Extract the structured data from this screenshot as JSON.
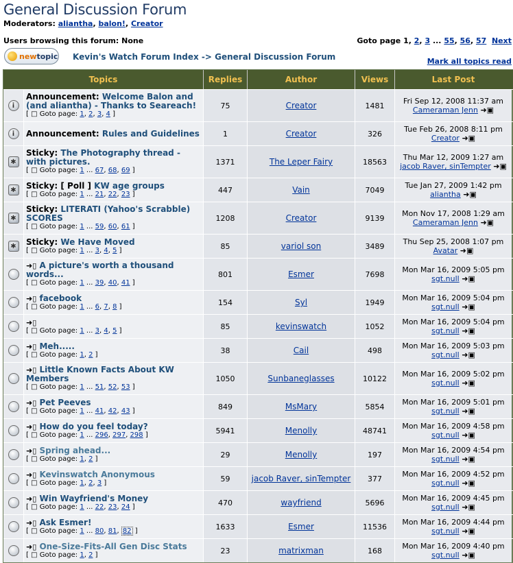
{
  "page": {
    "title": "General Discussion Forum",
    "moderators_label": "Moderators:",
    "moderators": [
      "aliantha",
      "balon!",
      "Creator"
    ],
    "browsing": "Users browsing this forum: None",
    "goto_label": "Goto page",
    "goto_current": "1",
    "goto_pages": [
      "2",
      "3",
      "...",
      "55",
      "56",
      "57"
    ],
    "goto_next": "Next",
    "new_topic_new": "new",
    "new_topic_topic": "topic",
    "breadcrumb": "Kevin's Watch Forum Index -> General Discussion Forum",
    "mark_all": "Mark all topics read"
  },
  "headers": {
    "topics": "Topics",
    "replies": "Replies",
    "author": "Author",
    "views": "Views",
    "last_post": "Last Post"
  },
  "colors": {
    "header_bg": "#4a5a2e",
    "header_text": "#f0c050",
    "link": "#003399",
    "title": "#1f3a64"
  },
  "goto_label_small": "Goto page:",
  "topics": [
    {
      "icon": "announcement-icon",
      "prefix": "Announcement:",
      "title": "Welcome Balon and (and aliantha) - Thanks to Seareach!",
      "pages": [
        "1",
        "2",
        "3",
        "4"
      ],
      "replies": "75",
      "author": "Creator",
      "views": "1481",
      "last_date": "Fri Sep 12, 2008 11:37 am",
      "last_user": "Cameraman Jenn"
    },
    {
      "icon": "announcement-icon",
      "prefix": "Announcement:",
      "title": "Rules and Guidelines",
      "pages": [],
      "replies": "1",
      "author": "Creator",
      "views": "326",
      "last_date": "Tue Feb 26, 2008 8:11 pm",
      "last_user": "Creator"
    },
    {
      "icon": "sticky-icon",
      "prefix": "Sticky:",
      "title": "The Photography thread - with pictures.",
      "pages": [
        "1",
        "...",
        "67",
        "68",
        "69"
      ],
      "replies": "1371",
      "author": "The Leper Fairy",
      "views": "18563",
      "last_date": "Thu Mar 12, 2009 1:27 am",
      "last_user": "jacob Raver, sinTempter"
    },
    {
      "icon": "sticky-icon",
      "prefix": "Sticky: [ Poll ]",
      "title": "KW age groups",
      "pages": [
        "1",
        "...",
        "21",
        "22",
        "23"
      ],
      "replies": "447",
      "author": "Vain",
      "views": "7049",
      "last_date": "Tue Jan 27, 2009 1:42 pm",
      "last_user": "aliantha"
    },
    {
      "icon": "sticky-icon",
      "prefix": "Sticky:",
      "title": "LITERATI (Yahoo's Scrabble) SCORES",
      "pages": [
        "1",
        "...",
        "59",
        "60",
        "61"
      ],
      "replies": "1208",
      "author": "Creator",
      "views": "9139",
      "last_date": "Mon Nov 17, 2008 1:29 am",
      "last_user": "Cameraman Jenn"
    },
    {
      "icon": "sticky-icon",
      "prefix": "Sticky:",
      "title": "We Have Moved",
      "pages": [
        "1",
        "...",
        "3",
        "4",
        "5"
      ],
      "replies": "85",
      "author": "variol son",
      "views": "3489",
      "last_date": "Thu Sep 25, 2008 1:07 pm",
      "last_user": "Avatar"
    },
    {
      "icon": "topic-icon",
      "prefix": "",
      "title": "A picture's worth a thousand words...",
      "pages": [
        "1",
        "...",
        "39",
        "40",
        "41"
      ],
      "replies": "801",
      "author": "Esmer",
      "views": "7698",
      "last_date": "Mon Mar 16, 2009 5:05 pm",
      "last_user": "sgt.null"
    },
    {
      "icon": "topic-icon",
      "prefix": "",
      "title": "facebook",
      "pages": [
        "1",
        "...",
        "6",
        "7",
        "8"
      ],
      "replies": "154",
      "author": "Syl",
      "views": "1949",
      "last_date": "Mon Mar 16, 2009 5:04 pm",
      "last_user": "sgt.null"
    },
    {
      "icon": "topic-icon",
      "prefix": "",
      "title": "",
      "pages": [
        "1",
        "...",
        "3",
        "4",
        "5"
      ],
      "replies": "85",
      "author": "kevinswatch",
      "views": "1052",
      "last_date": "Mon Mar 16, 2009 5:04 pm",
      "last_user": "sgt.null"
    },
    {
      "icon": "topic-icon",
      "prefix": "",
      "title": "Meh.....",
      "pages": [
        "1",
        "2"
      ],
      "replies": "38",
      "author": "Cail",
      "views": "498",
      "last_date": "Mon Mar 16, 2009 5:03 pm",
      "last_user": "sgt.null"
    },
    {
      "icon": "topic-icon",
      "prefix": "",
      "title": "Little Known Facts About KW Members",
      "pages": [
        "1",
        "...",
        "51",
        "52",
        "53"
      ],
      "replies": "1050",
      "author": "Sunbaneglasses",
      "views": "10122",
      "last_date": "Mon Mar 16, 2009 5:02 pm",
      "last_user": "sgt.null"
    },
    {
      "icon": "topic-icon",
      "prefix": "",
      "title": "Pet Peeves",
      "pages": [
        "1",
        "...",
        "41",
        "42",
        "43"
      ],
      "replies": "849",
      "author": "MsMary",
      "views": "5854",
      "last_date": "Mon Mar 16, 2009 5:01 pm",
      "last_user": "sgt.null"
    },
    {
      "icon": "topic-icon",
      "prefix": "",
      "title": "How do you feel today?",
      "pages": [
        "1",
        "...",
        "296",
        "297",
        "298"
      ],
      "replies": "5941",
      "author": "Menolly",
      "views": "48741",
      "last_date": "Mon Mar 16, 2009 4:58 pm",
      "last_user": "sgt.null"
    },
    {
      "icon": "topic-icon",
      "prefix": "",
      "title": "Spring ahead...",
      "visited": true,
      "pages": [
        "1",
        "2"
      ],
      "replies": "29",
      "author": "Menolly",
      "views": "197",
      "last_date": "Mon Mar 16, 2009 4:54 pm",
      "last_user": "sgt.null"
    },
    {
      "icon": "topic-icon",
      "prefix": "",
      "title": "Kevinswatch Anonymous",
      "visited": true,
      "pages": [
        "1",
        "2",
        "3"
      ],
      "replies": "59",
      "author": "jacob Raver, sinTempter",
      "views": "377",
      "last_date": "Mon Mar 16, 2009 4:52 pm",
      "last_user": "sgt.null"
    },
    {
      "icon": "topic-icon",
      "prefix": "",
      "title": "Win Wayfriend's Money",
      "pages": [
        "1",
        "...",
        "22",
        "23",
        "24"
      ],
      "replies": "470",
      "author": "wayfriend",
      "views": "5696",
      "last_date": "Mon Mar 16, 2009 4:45 pm",
      "last_user": "sgt.null"
    },
    {
      "icon": "topic-icon",
      "prefix": "",
      "title": "Ask Esmer!",
      "pages": [
        "1",
        "...",
        "80",
        "81",
        "82"
      ],
      "selected_page": "82",
      "replies": "1633",
      "author": "Esmer",
      "views": "11536",
      "last_date": "Mon Mar 16, 2009 4:44 pm",
      "last_user": "sgt.null"
    },
    {
      "icon": "topic-icon",
      "prefix": "",
      "title": "One-Size-Fits-All Gen Disc Stats",
      "visited": true,
      "pages": [
        "1",
        "2"
      ],
      "replies": "23",
      "author": "matrixman",
      "views": "168",
      "last_date": "Mon Mar 16, 2009 4:40 pm",
      "last_user": "sgt.null"
    }
  ]
}
